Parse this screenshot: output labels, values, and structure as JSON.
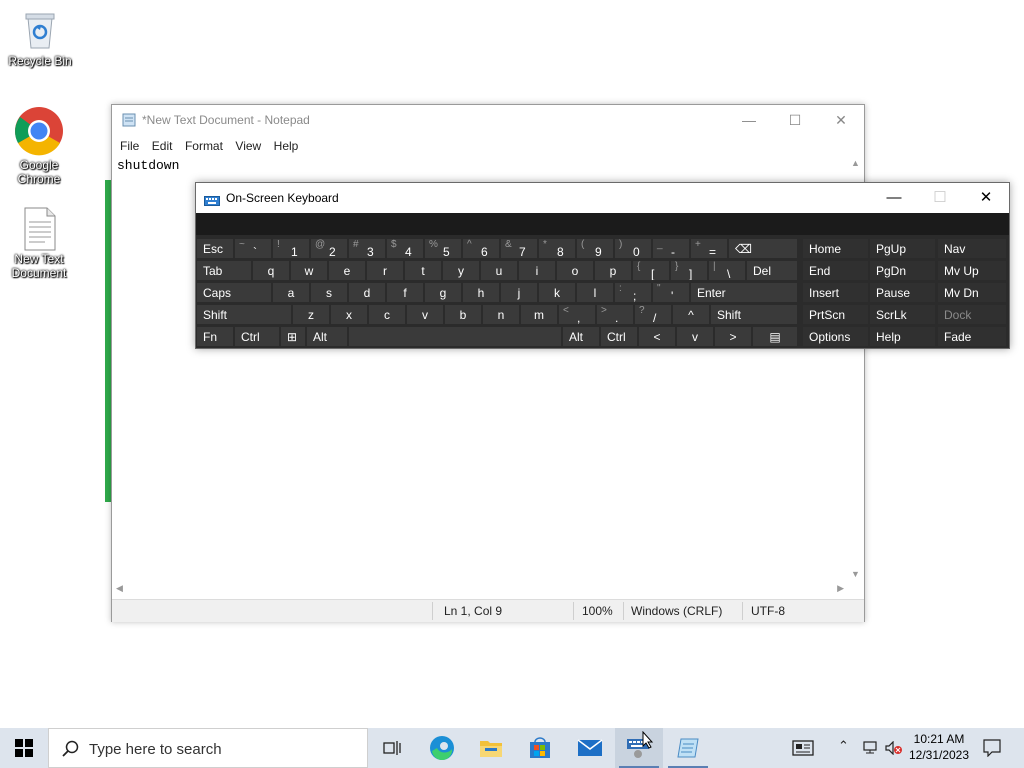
{
  "desktop": {
    "icons": [
      {
        "label_line1": "Recycle Bin",
        "label_line2": ""
      },
      {
        "label_line1": "Google",
        "label_line2": "Chrome"
      },
      {
        "label_line1": "New Text",
        "label_line2": "Document"
      }
    ]
  },
  "notepad": {
    "title": "*New Text Document - Notepad",
    "menu": [
      "File",
      "Edit",
      "Format",
      "View",
      "Help"
    ],
    "content": "shutdown",
    "status": {
      "position": "Ln 1, Col 9",
      "zoom": "100%",
      "line_ending": "Windows (CRLF)",
      "encoding": "UTF-8"
    }
  },
  "osk": {
    "title": "On-Screen Keyboard",
    "row1": [
      {
        "main": "Esc"
      },
      {
        "shift": "~",
        "base": "`"
      },
      {
        "shift": "!",
        "base": "1"
      },
      {
        "shift": "@",
        "base": "2"
      },
      {
        "shift": "#",
        "base": "3"
      },
      {
        "shift": "$",
        "base": "4"
      },
      {
        "shift": "%",
        "base": "5"
      },
      {
        "shift": "^",
        "base": "6"
      },
      {
        "shift": "&",
        "base": "7"
      },
      {
        "shift": "*",
        "base": "8"
      },
      {
        "shift": "(",
        "base": "9"
      },
      {
        "shift": ")",
        "base": "0"
      },
      {
        "shift": "_",
        "base": "-"
      },
      {
        "shift": "+",
        "base": "="
      },
      {
        "main": "⌫"
      }
    ],
    "row2": [
      {
        "main": "Tab"
      },
      {
        "c": "q"
      },
      {
        "c": "w"
      },
      {
        "c": "e"
      },
      {
        "c": "r"
      },
      {
        "c": "t"
      },
      {
        "c": "y"
      },
      {
        "c": "u"
      },
      {
        "c": "i"
      },
      {
        "c": "o"
      },
      {
        "c": "p"
      },
      {
        "shift": "{",
        "base": "["
      },
      {
        "shift": "}",
        "base": "]"
      },
      {
        "shift": "|",
        "base": "\\"
      },
      {
        "main": "Del"
      }
    ],
    "row3": [
      {
        "main": "Caps"
      },
      {
        "c": "a"
      },
      {
        "c": "s"
      },
      {
        "c": "d"
      },
      {
        "c": "f"
      },
      {
        "c": "g"
      },
      {
        "c": "h"
      },
      {
        "c": "j"
      },
      {
        "c": "k"
      },
      {
        "c": "l"
      },
      {
        "shift": ":",
        "base": ";"
      },
      {
        "shift": "\"",
        "base": "'"
      },
      {
        "main": "Enter"
      }
    ],
    "row4": [
      {
        "main": "Shift"
      },
      {
        "c": "z"
      },
      {
        "c": "x"
      },
      {
        "c": "c"
      },
      {
        "c": "v"
      },
      {
        "c": "b"
      },
      {
        "c": "n"
      },
      {
        "c": "m"
      },
      {
        "shift": "<",
        "base": ","
      },
      {
        "shift": ">",
        "base": "."
      },
      {
        "shift": "?",
        "base": "/"
      },
      {
        "c": "^"
      },
      {
        "main": "Shift"
      }
    ],
    "row5": [
      {
        "main": "Fn"
      },
      {
        "main": "Ctrl"
      },
      {
        "main": "⊞"
      },
      {
        "main": "Alt"
      },
      {
        "main": ""
      },
      {
        "main": "Alt"
      },
      {
        "main": "Ctrl"
      },
      {
        "c": "<"
      },
      {
        "c": "v"
      },
      {
        "c": ">"
      },
      {
        "c": "▤"
      }
    ],
    "nav": [
      [
        "Home",
        "PgUp",
        "Nav"
      ],
      [
        "End",
        "PgDn",
        "Mv Up"
      ],
      [
        "Insert",
        "Pause",
        "Mv Dn"
      ],
      [
        "PrtScn",
        "ScrLk",
        "Dock"
      ],
      [
        "Options",
        "Help",
        "Fade"
      ]
    ]
  },
  "taskbar": {
    "search_placeholder": "Type here to search",
    "time": "10:21 AM",
    "date": "12/31/2023"
  }
}
